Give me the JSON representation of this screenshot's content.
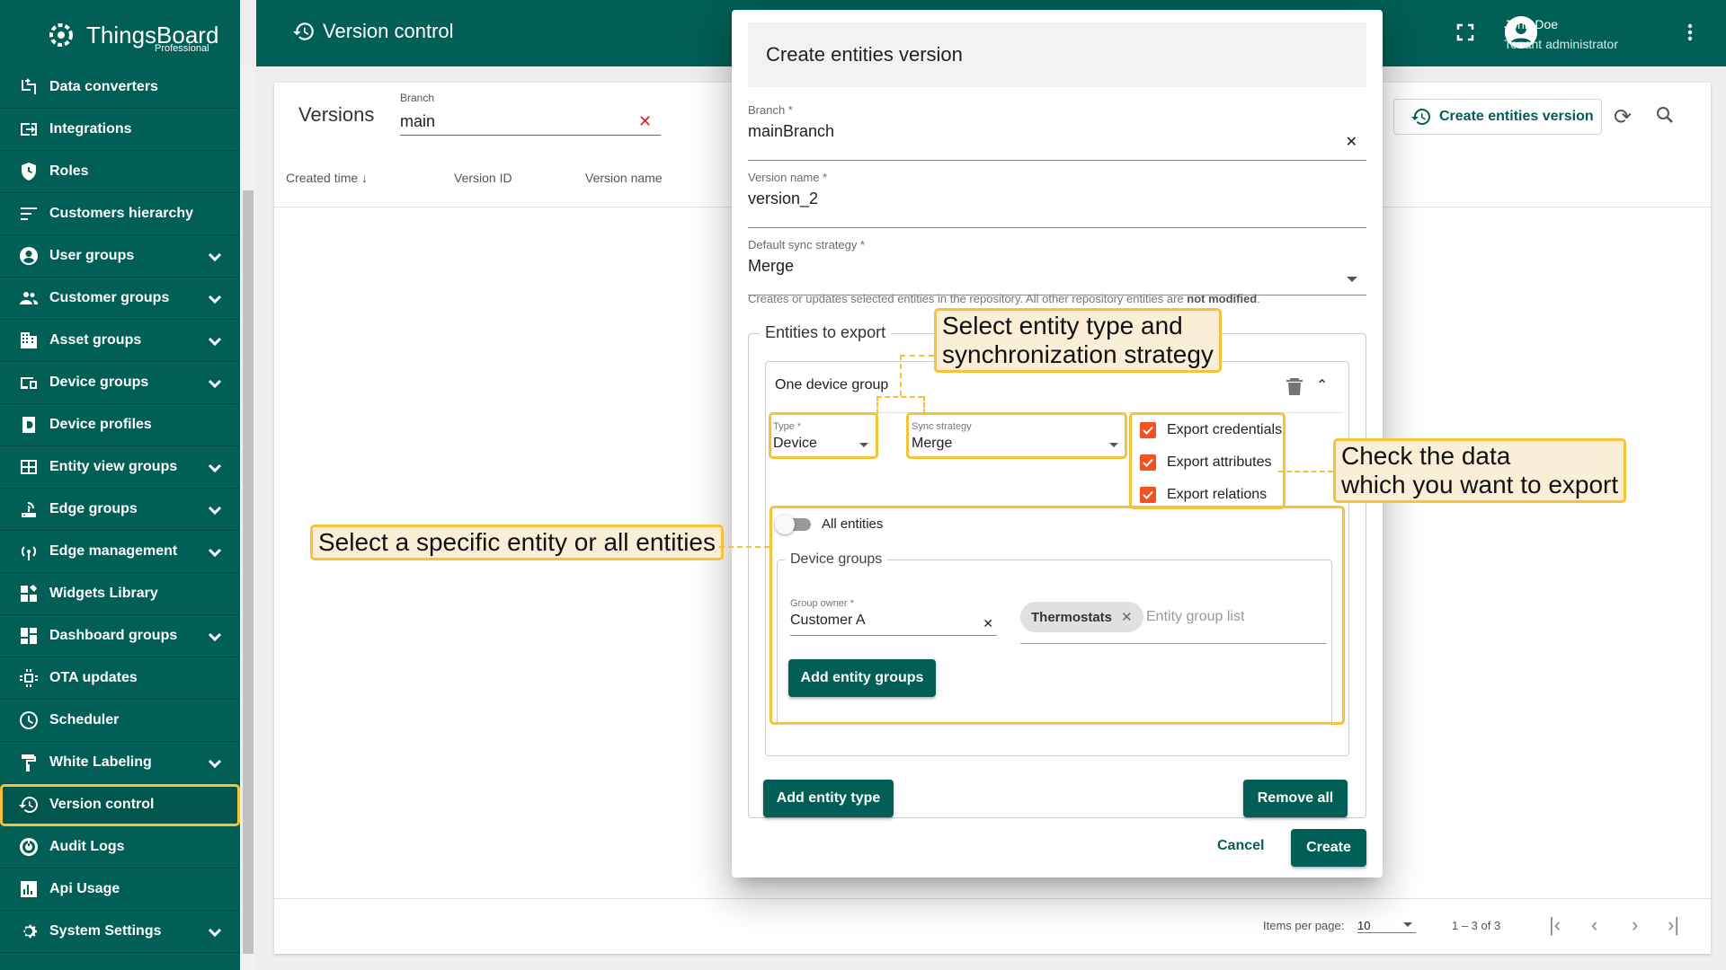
{
  "app": {
    "brand": "ThingsBoard",
    "edition": "Professional"
  },
  "sidebar": {
    "items": [
      {
        "label": "Data converters",
        "icon": "data-converter-icon",
        "expandable": false
      },
      {
        "label": "Integrations",
        "icon": "integrations-icon",
        "expandable": false
      },
      {
        "label": "Roles",
        "icon": "shield-icon",
        "expandable": false
      },
      {
        "label": "Customers hierarchy",
        "icon": "hierarchy-icon",
        "expandable": false
      },
      {
        "label": "User groups",
        "icon": "user-icon",
        "expandable": true
      },
      {
        "label": "Customer groups",
        "icon": "customers-icon",
        "expandable": true
      },
      {
        "label": "Asset groups",
        "icon": "building-icon",
        "expandable": true
      },
      {
        "label": "Device groups",
        "icon": "devices-icon",
        "expandable": true
      },
      {
        "label": "Device profiles",
        "icon": "device-profile-icon",
        "expandable": false
      },
      {
        "label": "Entity view groups",
        "icon": "entity-view-icon",
        "expandable": true
      },
      {
        "label": "Edge groups",
        "icon": "edge-icon",
        "expandable": true
      },
      {
        "label": "Edge management",
        "icon": "signal-icon",
        "expandable": true
      },
      {
        "label": "Widgets Library",
        "icon": "widgets-icon",
        "expandable": false
      },
      {
        "label": "Dashboard groups",
        "icon": "dashboard-icon",
        "expandable": true
      },
      {
        "label": "OTA updates",
        "icon": "chip-icon",
        "expandable": false
      },
      {
        "label": "Scheduler",
        "icon": "clock-icon",
        "expandable": false
      },
      {
        "label": "White Labeling",
        "icon": "paint-roller-icon",
        "expandable": true
      },
      {
        "label": "Version control",
        "icon": "history-icon",
        "expandable": false,
        "active": true
      },
      {
        "label": "Audit Logs",
        "icon": "audit-icon",
        "expandable": false
      },
      {
        "label": "Api Usage",
        "icon": "bar-chart-icon",
        "expandable": false
      },
      {
        "label": "System Settings",
        "icon": "gear-icon",
        "expandable": true
      }
    ]
  },
  "topbar": {
    "title": "Version control",
    "user_name": "John Doe",
    "user_role": "Tenant administrator"
  },
  "versions": {
    "title": "Versions",
    "branch_label": "Branch",
    "branch_value": "main",
    "create_button": "Create entities version",
    "columns": [
      "Created time",
      "Version ID",
      "Version name"
    ],
    "pager": {
      "items_per_page_label": "Items per page:",
      "items_per_page": "10",
      "range": "1 – 3 of 3"
    }
  },
  "dialog": {
    "title": "Create entities version",
    "branch_label": "Branch *",
    "branch_value": "mainBranch",
    "version_name_label": "Version name *",
    "version_name_value": "version_2",
    "sync_label": "Default sync strategy *",
    "sync_value": "Merge",
    "hint_prefix": "Creates or updates selected entities in the repository. All other repository entities are ",
    "hint_bold": "not modified",
    "hint_suffix": ".",
    "entities_legend": "Entities to export",
    "panel": {
      "title": "One device group",
      "type_label": "Type *",
      "type_value": "Device",
      "strategy_label": "Sync strategy",
      "strategy_value": "Merge",
      "checks": [
        "Export credentials",
        "Export attributes",
        "Export relations"
      ],
      "all_entities_label": "All entities",
      "groups_legend": "Device groups",
      "owner_label": "Group owner *",
      "owner_value": "Customer A",
      "chip": "Thermostats",
      "group_placeholder": "Entity group list",
      "add_groups_button": "Add entity groups"
    },
    "add_type_button": "Add entity type",
    "remove_all_button": "Remove all",
    "cancel_button": "Cancel",
    "create_button": "Create"
  },
  "callouts": {
    "entity_type": [
      "Select entity type and",
      "synchronization strategy"
    ],
    "check_data": [
      "Check the data",
      "which you want to export"
    ],
    "select_entity": "Select a specific entity or all entities"
  },
  "colors": {
    "primary": "#025f55",
    "highlight": "#f8c13a",
    "callout_bg": "#fbeed6",
    "checkbox": "#f4511e"
  }
}
